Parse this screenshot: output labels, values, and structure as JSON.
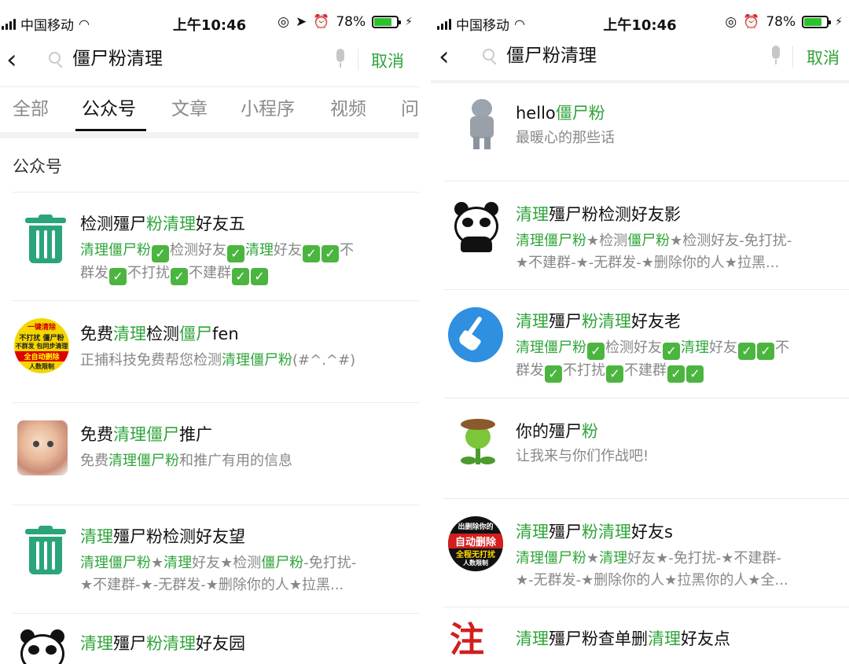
{
  "status_left": {
    "carrier": "中国移动",
    "time": "上午10:46",
    "battery": "78%",
    "battery_level": 0.78
  },
  "status_right": {
    "carrier": "中国移动",
    "time": "上午10:46",
    "battery": "78%",
    "battery_level": 0.78
  },
  "search_left": {
    "query": "僵尸粉清理",
    "cancel": "取消"
  },
  "search_right": {
    "query": "僵尸粉清理",
    "cancel": "取消"
  },
  "tabs": [
    "全部",
    "公众号",
    "文章",
    "小程序",
    "视频",
    "问"
  ],
  "active_tab": "公众号",
  "section_title": "公众号",
  "check_mark": "✓",
  "left_results": [
    {
      "icon": "trash-can-icon",
      "title": [
        [
          "检测殭尸",
          ""
        ],
        [
          "粉清理",
          "g"
        ],
        [
          "好友五",
          ""
        ]
      ],
      "desc_lines": [
        [
          [
            "清理僵尸粉",
            "g"
          ],
          [
            "✓",
            "ck"
          ],
          [
            "检测好友",
            ""
          ],
          [
            "✓",
            "ck"
          ],
          [
            "清理",
            "g"
          ],
          [
            "好友",
            ""
          ],
          [
            "✓",
            "ck"
          ],
          [
            "✓",
            "ck"
          ],
          [
            "不",
            ""
          ]
        ],
        [
          [
            "群发",
            ""
          ],
          [
            "✓",
            "ck"
          ],
          [
            "不打扰",
            ""
          ],
          [
            "✓",
            "ck"
          ],
          [
            "不建群",
            ""
          ],
          [
            "✓",
            "ck"
          ],
          [
            "✓",
            "ck"
          ]
        ]
      ]
    },
    {
      "icon": "ad-badge-icon",
      "icon_text": [
        "一键清除",
        "不打扰 僵尸粉",
        "不群发 包同步清理",
        "全自动删除",
        "人数限制"
      ],
      "title": [
        [
          "免费",
          ""
        ],
        [
          "清理",
          "g"
        ],
        [
          "检测",
          ""
        ],
        [
          "僵尸",
          "g"
        ],
        [
          "fen",
          ""
        ]
      ],
      "desc_lines": [
        [
          [
            "正捕科技免费帮您检测",
            ""
          ],
          [
            "清理僵尸粉",
            "g"
          ],
          [
            "(#^.^#)",
            ""
          ]
        ]
      ]
    },
    {
      "icon": "cat-avatar-icon",
      "title": [
        [
          "免费",
          ""
        ],
        [
          "清理僵尸",
          "g"
        ],
        [
          "推广",
          ""
        ]
      ],
      "desc_lines": [
        [
          [
            "免费",
            ""
          ],
          [
            "清理僵尸粉",
            "g"
          ],
          [
            "和推广有用的信息",
            ""
          ]
        ]
      ]
    },
    {
      "icon": "trash-can-icon",
      "title": [
        [
          "清理",
          "g"
        ],
        [
          "殭尸粉检测好友望",
          ""
        ]
      ],
      "desc_lines": [
        [
          [
            "清理僵尸粉",
            "g"
          ],
          [
            "★",
            ""
          ],
          [
            "清理",
            "g"
          ],
          [
            "好友★检测",
            ""
          ],
          [
            "僵尸粉",
            "g"
          ],
          [
            "-免打扰-",
            ""
          ]
        ],
        [
          [
            "★不建群-★-无群发-★删除你的人★拉黑...",
            ""
          ]
        ]
      ]
    },
    {
      "icon": "panda-avatar-icon",
      "title": [
        [
          "清理",
          "g"
        ],
        [
          "殭尸",
          ""
        ],
        [
          "粉清理",
          "g"
        ],
        [
          "好友园",
          ""
        ]
      ],
      "desc_lines": []
    }
  ],
  "right_results": [
    {
      "icon": "zombie-avatar-icon",
      "title": [
        [
          "hello",
          ""
        ],
        [
          "僵尸粉",
          "g"
        ]
      ],
      "desc_lines": [
        [
          [
            "最暖心的那些话",
            ""
          ]
        ]
      ]
    },
    {
      "icon": "panda-avatar-icon",
      "title": [
        [
          "清理",
          "g"
        ],
        [
          "殭尸粉检测好友影",
          ""
        ]
      ],
      "desc_lines": [
        [
          [
            "清理僵尸粉",
            "g"
          ],
          [
            "★检测",
            ""
          ],
          [
            "僵尸粉",
            "g"
          ],
          [
            "★检测好友-免打扰-",
            ""
          ]
        ],
        [
          [
            "★不建群-★-无群发-★删除你的人★拉黑...",
            ""
          ]
        ]
      ]
    },
    {
      "icon": "broom-icon",
      "title": [
        [
          "清理",
          "g"
        ],
        [
          "殭尸",
          ""
        ],
        [
          "粉清理",
          "g"
        ],
        [
          "好友老",
          ""
        ]
      ],
      "desc_lines": [
        [
          [
            "清理僵尸粉",
            "g"
          ],
          [
            "✓",
            "ck"
          ],
          [
            "检测好友",
            ""
          ],
          [
            "✓",
            "ck"
          ],
          [
            "清理",
            "g"
          ],
          [
            "好友",
            ""
          ],
          [
            "✓",
            "ck"
          ],
          [
            "✓",
            "ck"
          ],
          [
            "不",
            ""
          ]
        ],
        [
          [
            "群发",
            ""
          ],
          [
            "✓",
            "ck"
          ],
          [
            "不打扰",
            ""
          ],
          [
            "✓",
            "ck"
          ],
          [
            "不建群",
            ""
          ],
          [
            "✓",
            "ck"
          ],
          [
            "✓",
            "ck"
          ]
        ]
      ]
    },
    {
      "icon": "plant-avatar-icon",
      "title": [
        [
          "你的殭尸",
          ""
        ],
        [
          "粉",
          "g"
        ]
      ],
      "desc_lines": [
        [
          [
            "让我来与你们作战吧!",
            ""
          ]
        ]
      ]
    },
    {
      "icon": "ad-circle-icon",
      "icon_text": [
        "出删除你的",
        "自动删除",
        "全程无打扰",
        "人数限制"
      ],
      "title": [
        [
          "清理",
          "g"
        ],
        [
          "殭尸",
          ""
        ],
        [
          "粉清理",
          "g"
        ],
        [
          "好友s",
          ""
        ]
      ],
      "desc_lines": [
        [
          [
            "清理僵尸粉",
            "g"
          ],
          [
            "★",
            ""
          ],
          [
            "清理",
            "g"
          ],
          [
            "好友★-免打扰-★不建群-",
            ""
          ]
        ],
        [
          [
            "★-无群发-★删除你的人★拉黑你的人★全...",
            ""
          ]
        ]
      ]
    },
    {
      "icon": "red-char-icon",
      "icon_text": [
        "注"
      ],
      "title": [
        [
          "清理",
          "g"
        ],
        [
          "殭尸粉查单删",
          ""
        ],
        [
          "清理",
          "g"
        ],
        [
          "好友点",
          ""
        ]
      ],
      "desc_lines": []
    }
  ]
}
